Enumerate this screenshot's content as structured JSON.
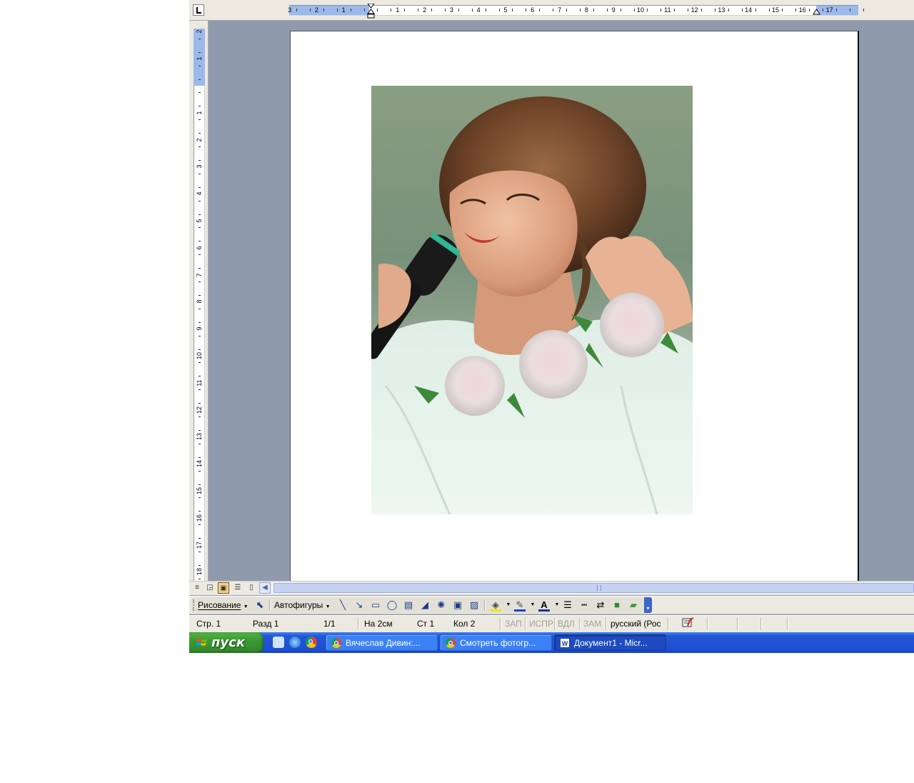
{
  "ruler": {
    "h_left_numbers": [
      "3",
      "2",
      "1"
    ],
    "h_right_numbers": [
      "1",
      "2",
      "3",
      "4",
      "5",
      "6",
      "7",
      "8",
      "9",
      "10",
      "11",
      "12",
      "13",
      "14",
      "15",
      "16",
      "17"
    ],
    "v_top_numbers": [
      "2",
      "1"
    ],
    "v_numbers": [
      "1",
      "2",
      "3",
      "4",
      "5",
      "6",
      "7",
      "8",
      "9",
      "10",
      "11",
      "12",
      "13",
      "14",
      "15",
      "16",
      "17",
      "18"
    ]
  },
  "document": {
    "image": "portrait-photo-singer-with-microphone"
  },
  "view_buttons": {
    "normal": "normal-view-icon",
    "web": "web-layout-icon",
    "print": "print-layout-icon",
    "outline": "outline-view-icon",
    "reading": "reading-layout-icon"
  },
  "drawing_toolbar": {
    "draw_menu": "Рисование",
    "autoshapes_menu": "Автофигуры",
    "tools": [
      "select-objects-icon",
      "line-icon",
      "arrow-icon",
      "rectangle-icon",
      "oval-icon",
      "text-box-icon",
      "wordart-icon",
      "diagram-icon",
      "clip-art-icon",
      "picture-icon",
      "fill-color-icon",
      "line-color-icon",
      "font-color-icon",
      "line-style-icon",
      "dash-style-icon",
      "arrow-style-icon",
      "shadow-icon",
      "3d-icon"
    ]
  },
  "status_bar": {
    "page": "Стр. 1",
    "section": "Разд 1",
    "page_of": "1/1",
    "at": "На 2см",
    "line": "Ст 1",
    "column": "Кол 2",
    "rec": "ЗАП",
    "trk": "ИСПР",
    "ext": "ВДЛ",
    "ovr": "ЗАМ",
    "language": "русский (Рос"
  },
  "taskbar": {
    "start_label": "пуск",
    "tasks": [
      {
        "label": "Вячеслав Дивин:...",
        "icon": "chrome-icon",
        "active": false
      },
      {
        "label": "Смотреть фотогр...",
        "icon": "chrome-icon",
        "active": false
      },
      {
        "label": "Документ1 - Micr...",
        "icon": "word-icon",
        "active": true
      }
    ]
  },
  "colors": {
    "workspace": "#8f9aad",
    "ruler_margin": "#9db9eb",
    "taskbar": "#2455d4",
    "start_button": "#3a9a33"
  }
}
